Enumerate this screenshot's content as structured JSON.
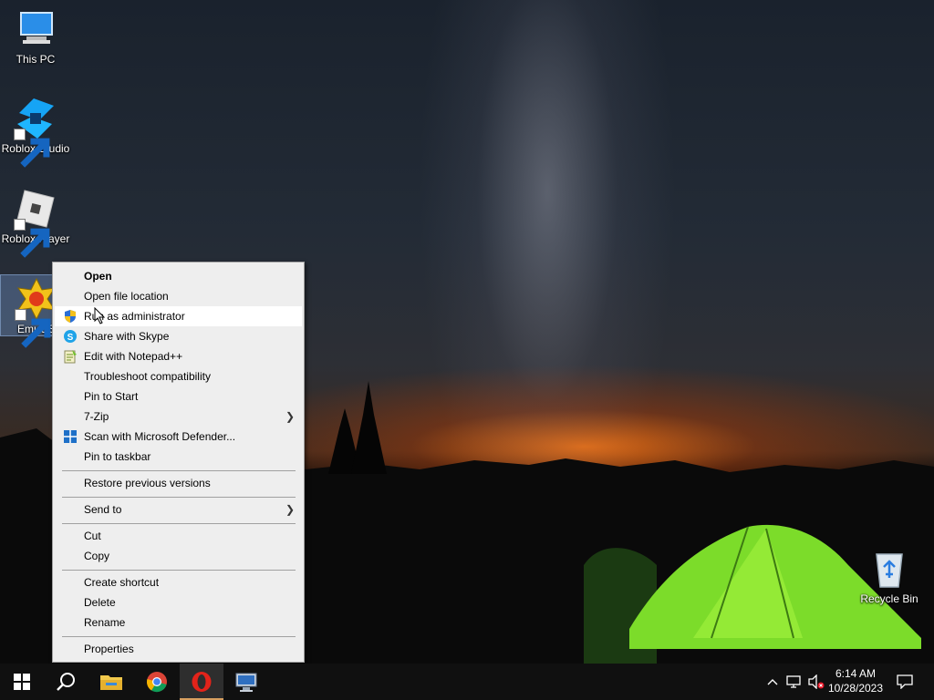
{
  "desktop": {
    "icons": [
      {
        "label": "This PC"
      },
      {
        "label": "Roblox Studio"
      },
      {
        "label": "Roblox Player"
      },
      {
        "label": "EmuOS"
      },
      {
        "label": "Recycle Bin"
      }
    ]
  },
  "context_menu": {
    "items": [
      {
        "label": "Open"
      },
      {
        "label": "Open file location"
      },
      {
        "label": "Run as administrator",
        "icon": "shield-icon"
      },
      {
        "label": "Share with Skype",
        "icon": "skype-icon"
      },
      {
        "label": "Edit with Notepad++",
        "icon": "notepadpp-icon"
      },
      {
        "label": "Troubleshoot compatibility"
      },
      {
        "label": "Pin to Start"
      },
      {
        "label": "7-Zip"
      },
      {
        "label": "Scan with Microsoft Defender...",
        "icon": "defender-icon"
      },
      {
        "label": "Pin to taskbar"
      },
      {
        "label": "Restore previous versions"
      },
      {
        "label": "Send to"
      },
      {
        "label": "Cut"
      },
      {
        "label": "Copy"
      },
      {
        "label": "Create shortcut"
      },
      {
        "label": "Delete"
      },
      {
        "label": "Rename"
      },
      {
        "label": "Properties"
      }
    ]
  },
  "taskbar": {
    "apps": [
      "start-icon",
      "search-icon",
      "file-explorer-icon",
      "chrome-icon",
      "opera-icon",
      "remote-desktop-icon"
    ],
    "clock": {
      "time": "6:14 AM",
      "date": "10/28/2023"
    }
  },
  "colors": {
    "menu_bg": "#eeeeee",
    "taskbar_bg": "#101010",
    "tent_green": "#7cdc2a"
  }
}
